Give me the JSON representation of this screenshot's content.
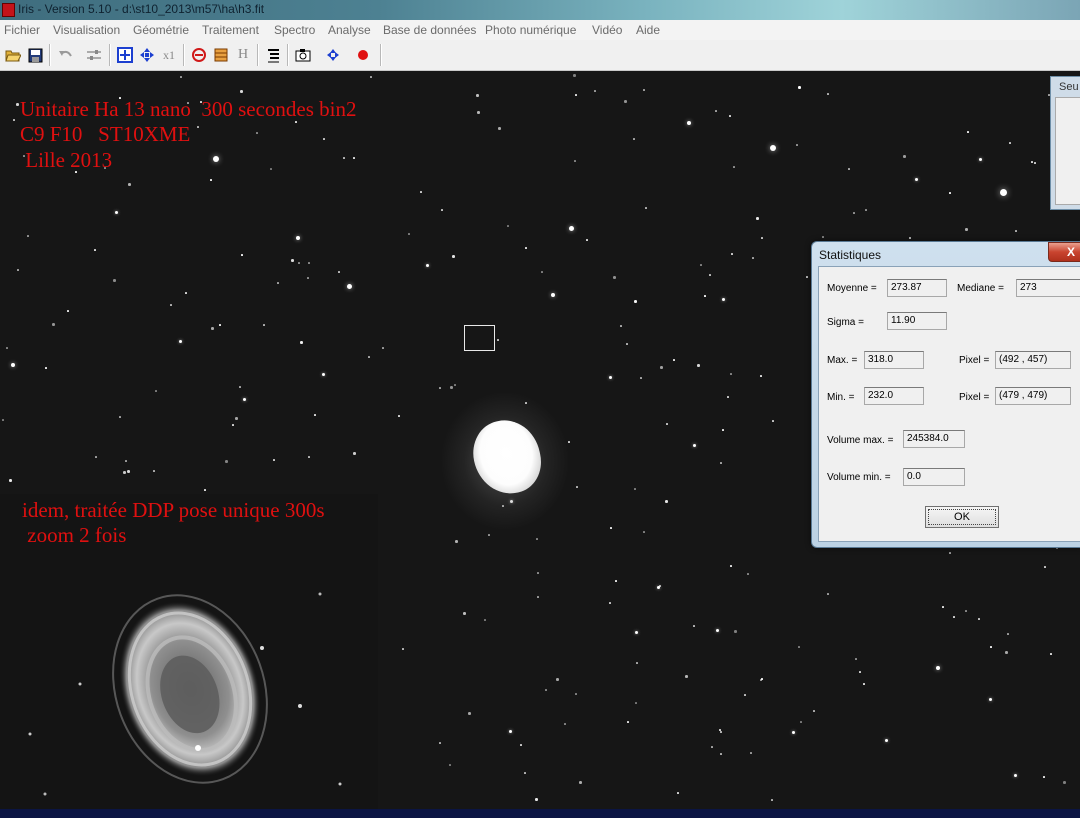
{
  "window": {
    "title": "Iris - Version 5.10 - d:\\st10_2013\\m57\\ha\\h3.fit"
  },
  "menu": [
    "Fichier",
    "Visualisation",
    "Géométrie",
    "Traitement",
    "Spectro",
    "Analyse",
    "Base de données",
    "Photo numérique",
    "Vidéo",
    "Aide"
  ],
  "toolbar": {
    "buttons": [
      "open-icon",
      "save-icon",
      "undo-icon",
      "sliders-icon",
      "zoom-fit-icon",
      "pan-icon",
      "zoom-1x-icon",
      "rotate-icon",
      "histogram-icon",
      "header-icon",
      "list-icon",
      "camera-icon",
      "move-icon",
      "record-icon"
    ],
    "zoom_label": "x1",
    "header_label": "H"
  },
  "annotations": {
    "main_line1": "Unitaire Ha 13 nano  300 secondes bin2",
    "main_line2": "C9 F10   ST10XME",
    "main_line3": " Lille 2013",
    "inset_line1": "idem, traitée DDP pose unique 300s",
    "inset_line2": " zoom 2 fois"
  },
  "seuils_panel": {
    "label": "Seu"
  },
  "statistics": {
    "title": "Statistiques",
    "close_label": "X",
    "moyenne_label": "Moyenne =",
    "moyenne_value": "273.87",
    "mediane_label": "Mediane =",
    "mediane_value": "273",
    "sigma_label": "Sigma =",
    "sigma_value": "11.90",
    "max_label": "Max. =",
    "max_value": "318.0",
    "max_pixel_label": "Pixel =",
    "max_pixel_value": "(492 , 457)",
    "min_label": "Min. =",
    "min_value": "232.0",
    "min_pixel_label": "Pixel =",
    "min_pixel_value": "(479 , 479)",
    "volume_max_label": "Volume max. =",
    "volume_max_value": "245384.0",
    "volume_min_label": "Volume min. =",
    "volume_min_value": "0.0",
    "ok_label": "OK"
  },
  "colors": {
    "annotation_text": "#e01010",
    "background": "#161616",
    "dialog_frame": "#bcd2e4",
    "close_button": "#c9442f"
  }
}
